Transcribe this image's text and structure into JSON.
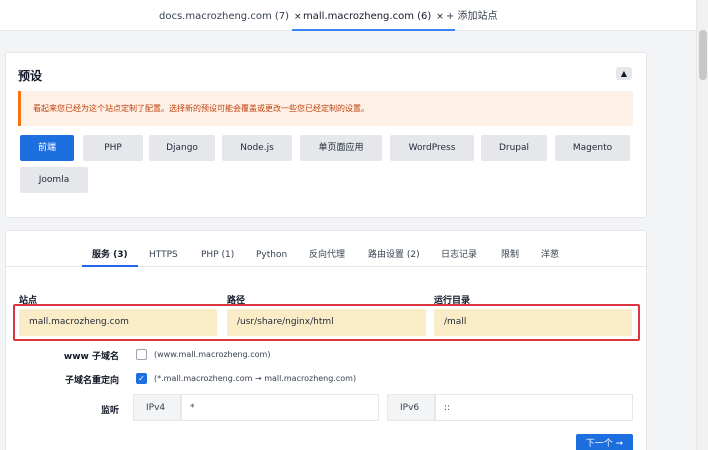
{
  "tabs": [
    {
      "label": "docs.macrozheng.com (7)",
      "close": "×"
    },
    {
      "label": "mall.macrozheng.com (6)",
      "close": "×"
    },
    {
      "label": "+ 添加站点"
    }
  ],
  "preset": {
    "title": "预设",
    "collapse_icon": "▲",
    "warning": "看起来您已经为这个站点定制了配置。选择新的预设可能会覆盖或更改一些您已经定制的设置。",
    "buttons": [
      "前端",
      "PHP",
      "Django",
      "Node.js",
      "单页面应用",
      "WordPress",
      "Drupal",
      "Magento",
      "Joomla"
    ]
  },
  "config_tabs": [
    "服务 (3)",
    "HTTPS",
    "PHP (1)",
    "Python",
    "反向代理",
    "路由设置 (2)",
    "日志记录",
    "限制",
    "洋葱"
  ],
  "fields": {
    "site_label": "站点",
    "site_value": "mall.macrozheng.com",
    "path_label": "路径",
    "path_value": "/usr/share/nginx/html",
    "root_label": "运行目录",
    "root_value": "/mall"
  },
  "www": {
    "label": "www 子域名",
    "hint": "(www.mall.macrozheng.com)"
  },
  "redirect": {
    "label": "子域名重定向",
    "hint": "(*.mall.macrozheng.com → mall.macrozheng.com)",
    "check": "✓"
  },
  "listen": {
    "label": "监听",
    "ipv4_label": "IPv4",
    "ipv4_value": "*",
    "ipv6_label": "IPv6",
    "ipv6_value": "::"
  },
  "next_button": "下一个 ➞",
  "colors": {
    "accent": "#1d6fe0",
    "highlight_border": "#d9363e",
    "field_bg": "#fbecc8",
    "warning_bg": "#fdf1e7"
  }
}
